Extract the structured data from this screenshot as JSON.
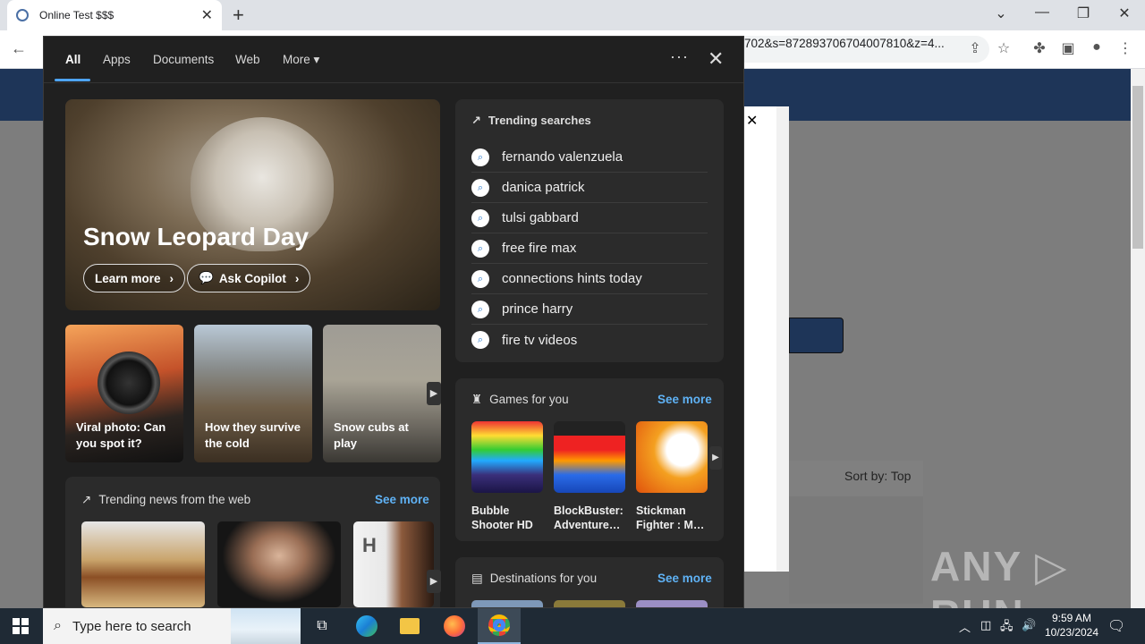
{
  "browser": {
    "tab_title": "Online Test $$$",
    "new_tab": "+",
    "url": "702&s=872893706704007810&z=4...",
    "window_controls": {
      "dropdown": "⌄",
      "minimize": "—",
      "restore": "❐",
      "close": "✕"
    }
  },
  "page": {
    "modal_close": "✕",
    "sort_label": "Sort by:  Top",
    "watermark": "ANY ▷ RUN"
  },
  "search_panel": {
    "tabs": [
      {
        "label": "All",
        "active": true
      },
      {
        "label": "Apps"
      },
      {
        "label": "Documents"
      },
      {
        "label": "Web"
      },
      {
        "label": "More"
      }
    ],
    "more_caret": "▾",
    "menu_dots": "···",
    "close": "✕",
    "hero": {
      "title": "Snow Leopard Day",
      "learn_more": "Learn more",
      "ask_copilot": "Ask Copilot"
    },
    "cards": [
      {
        "label": "Viral photo: Can you spot it?"
      },
      {
        "label": "How they survive the cold"
      },
      {
        "label": "Snow cubs at play"
      }
    ],
    "news": {
      "header": "Trending news from the web",
      "see_more": "See more",
      "thumb3_letter": "H"
    },
    "trending": {
      "header": "Trending searches",
      "items": [
        "fernando valenzuela",
        "danica patrick",
        "tulsi gabbard",
        "free fire max",
        "connections hints today",
        "prince harry",
        "fire tv videos"
      ]
    },
    "games": {
      "header": "Games for you",
      "see_more": "See more",
      "items": [
        {
          "name_line1": "Bubble",
          "name_line2": "Shooter HD"
        },
        {
          "name_line1": "BlockBuster:",
          "name_line2": "Adventures ..."
        },
        {
          "name_line1": "Stickman",
          "name_line2": "Fighter : Me..."
        }
      ]
    },
    "destinations": {
      "header": "Destinations for you",
      "see_more": "See more"
    }
  },
  "taskbar": {
    "search_placeholder": "Type here to search",
    "time": "9:59 AM",
    "date": "10/23/2024"
  }
}
